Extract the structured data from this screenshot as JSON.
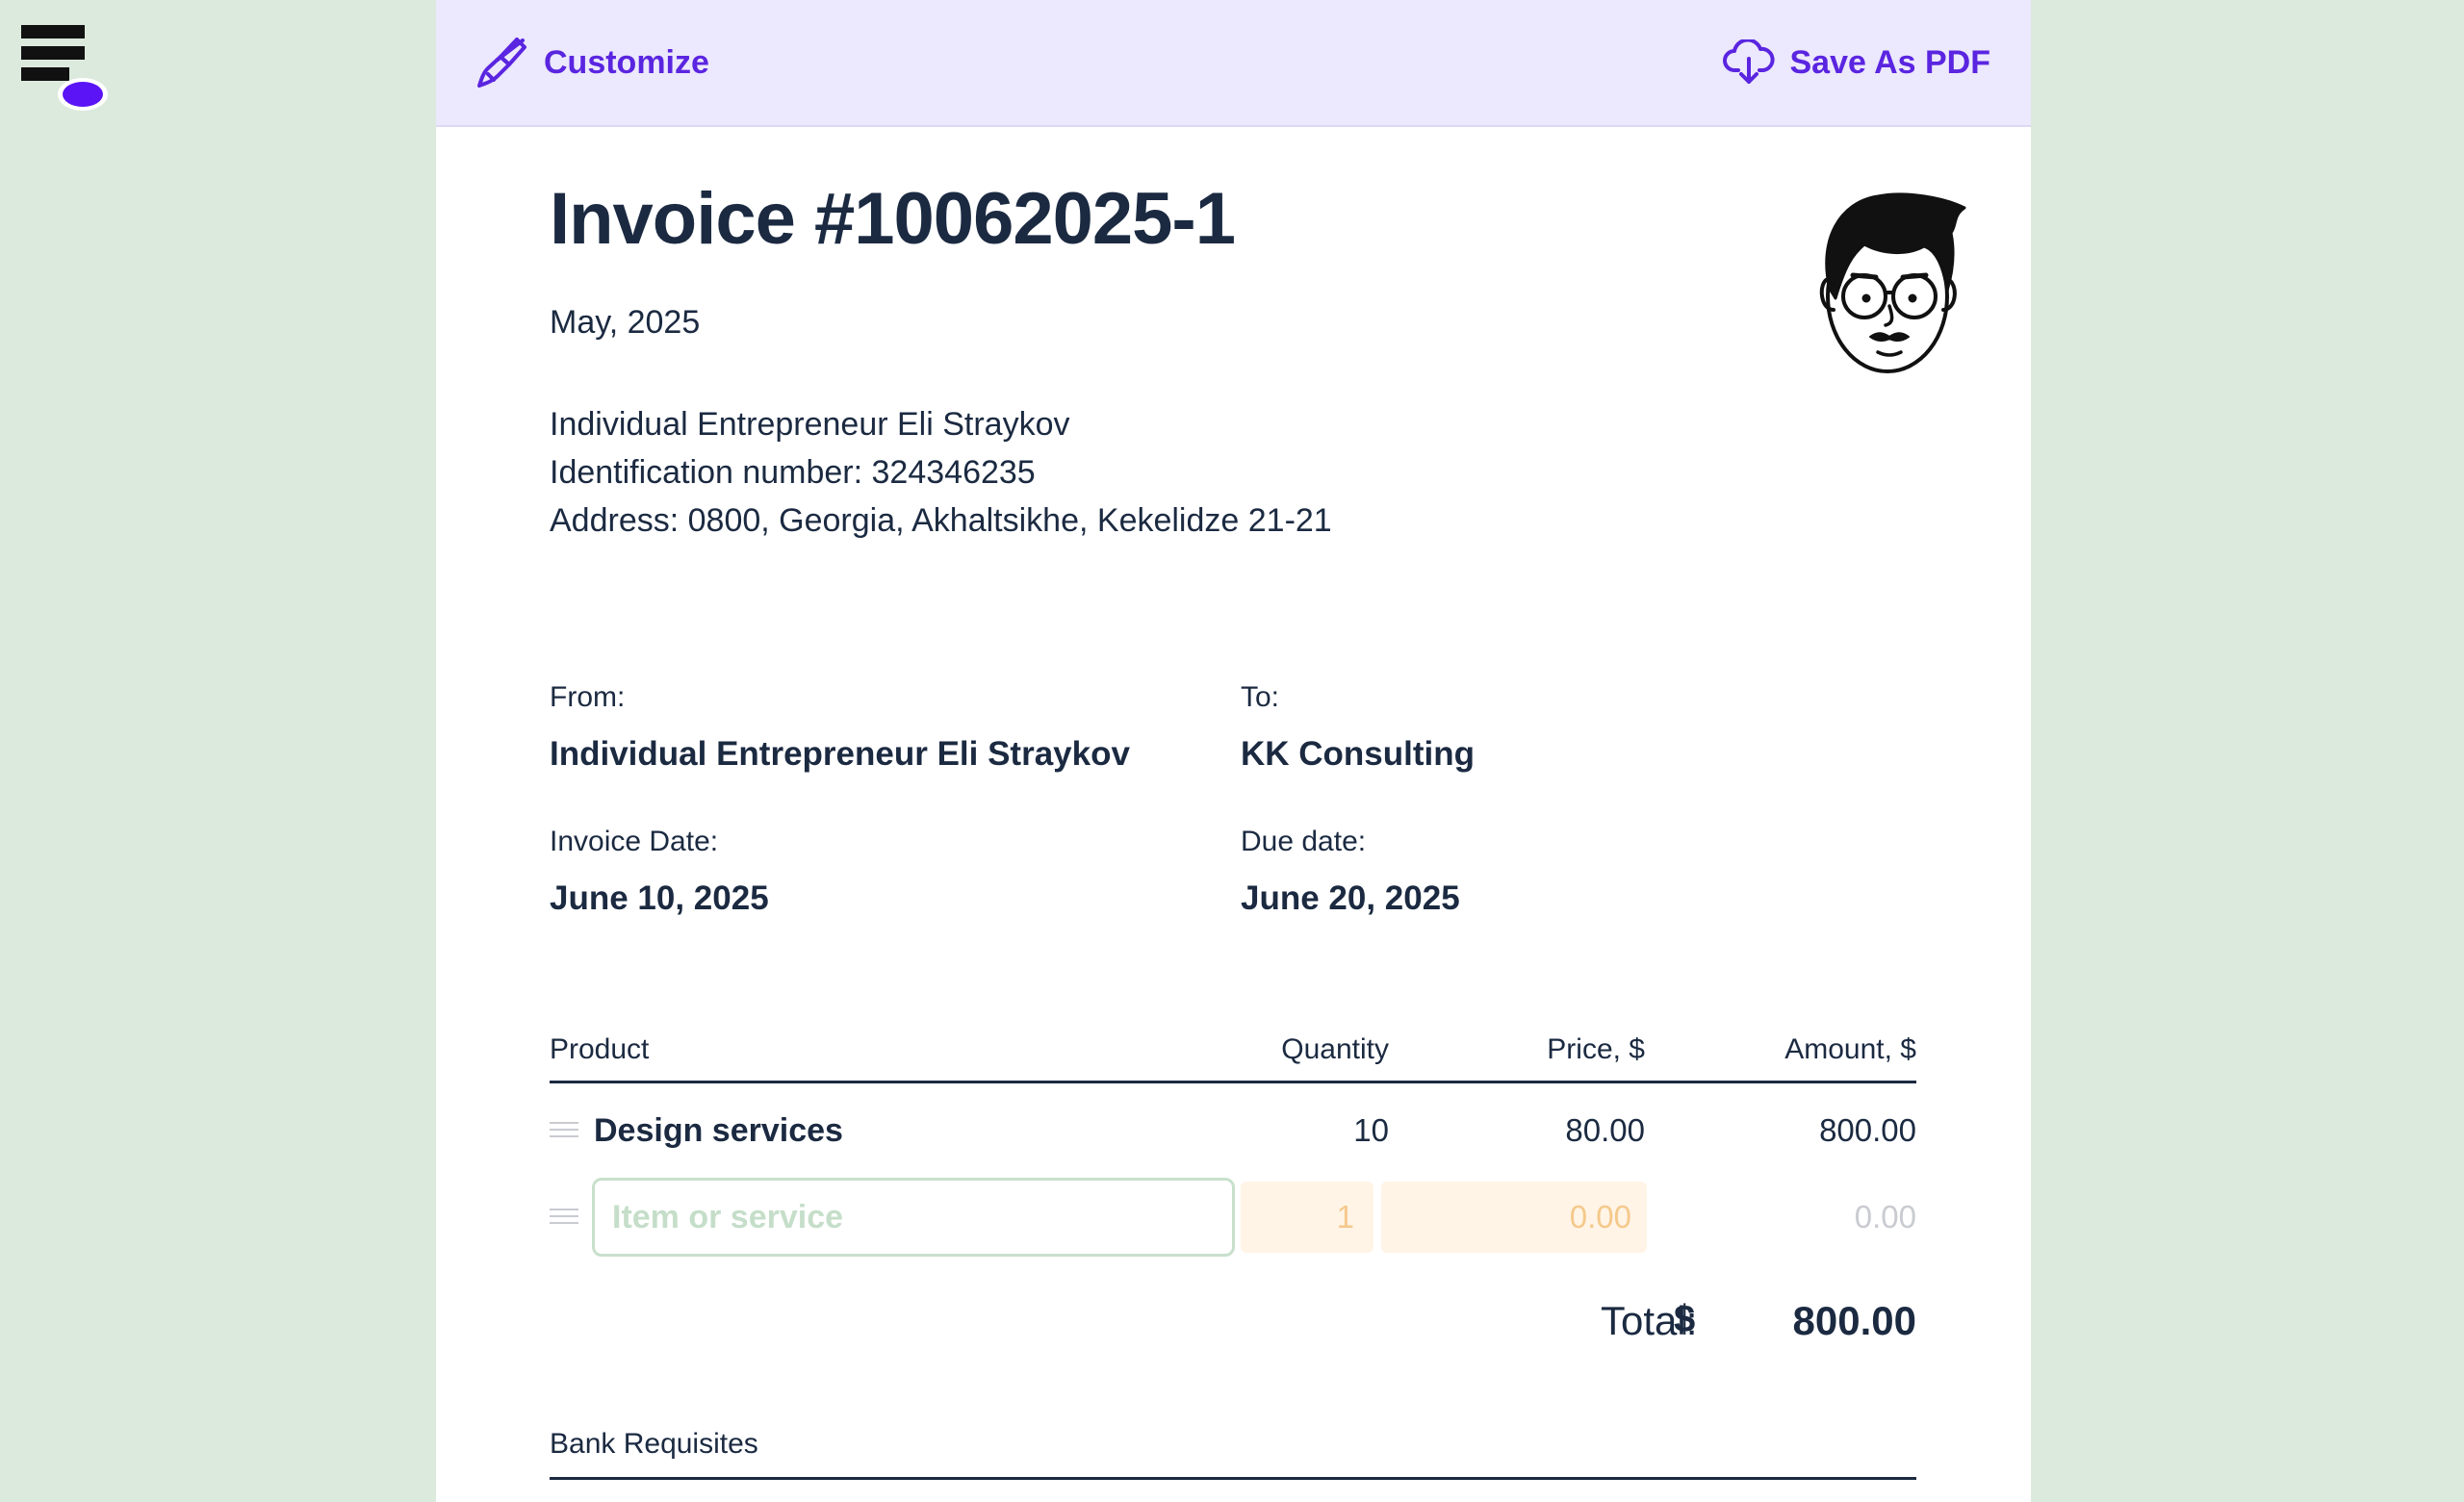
{
  "brand": {
    "logo_icon": "app-logo-icon",
    "accent": "#5a25e0"
  },
  "toolbar": {
    "customize_label": "Customize",
    "customize_icon": "paintbrush-icon",
    "save_label": "Save As PDF",
    "save_icon": "cloud-download-icon"
  },
  "invoice": {
    "title": "Invoice #10062025-1",
    "period": "May, 2025",
    "issuer_lines": [
      "Individual Entrepreneur Eli Straykov",
      "Identification number: 324346235",
      "Address: 0800, Georgia, Akhaltsikhe, Kekelidze 21-21"
    ],
    "avatar_icon": "cartoon-face-icon",
    "from_label": "From:",
    "from_value": "Individual Entrepreneur Eli Straykov",
    "to_label": "To:",
    "to_value": "KK Consulting",
    "invoice_date_label": "Invoice Date:",
    "invoice_date_value": "June 10, 2025",
    "due_date_label": "Due date:",
    "due_date_value": "June 20, 2025"
  },
  "table": {
    "headers": [
      "Product",
      "Quantity",
      "Price, $",
      "Amount, $"
    ],
    "rows": [
      {
        "product": "Design services",
        "quantity": "10",
        "price": "80.00",
        "amount": "800.00"
      }
    ],
    "new_row": {
      "placeholder": "Item or service",
      "quantity": "1",
      "price": "0.00",
      "amount": "0.00"
    }
  },
  "total": {
    "label": "Total:",
    "currency": "$",
    "value": "800.00"
  },
  "bank": {
    "label": "Bank Requisites"
  }
}
